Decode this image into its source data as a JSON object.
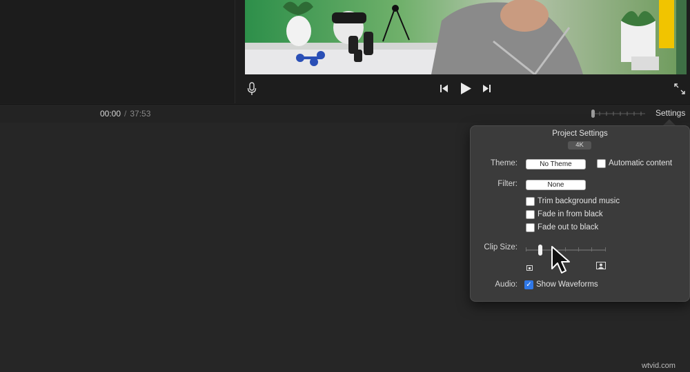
{
  "player": {
    "mic_icon": "microphone-icon",
    "prev_icon": "skip-back-icon",
    "play_icon": "play-icon",
    "next_icon": "skip-forward-icon",
    "fullscreen_icon": "fullscreen-icon"
  },
  "timeline": {
    "current_time": "00:00",
    "separator": "/",
    "total_time": "37:53",
    "settings_label": "Settings"
  },
  "project_settings": {
    "title": "Project Settings",
    "resolution": "4K",
    "theme_label": "Theme:",
    "theme_value": "No Theme",
    "automatic_content_label": "Automatic content",
    "automatic_content_checked": false,
    "filter_label": "Filter:",
    "filter_value": "None",
    "options": [
      {
        "label": "Trim background music",
        "checked": false
      },
      {
        "label": "Fade in from black",
        "checked": false
      },
      {
        "label": "Fade out to black",
        "checked": false
      }
    ],
    "clip_size_label": "Clip Size:",
    "clip_size_fraction": 0.2,
    "audio_label": "Audio:",
    "show_waveforms_label": "Show Waveforms",
    "show_waveforms_checked": true
  },
  "watermark": "wtvid.com"
}
